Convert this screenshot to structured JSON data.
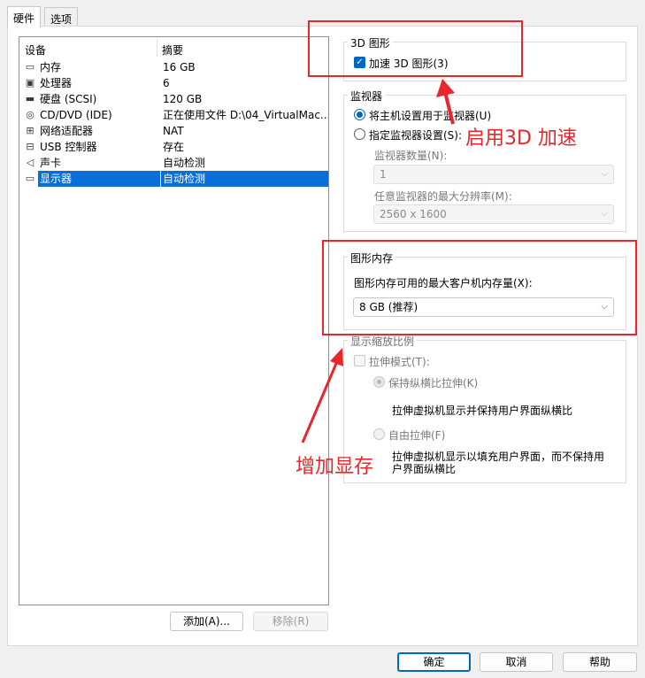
{
  "tabs": [
    "硬件",
    "选项"
  ],
  "device_list": {
    "headers": [
      "设备",
      "摘要"
    ],
    "rows": [
      {
        "name": "内存",
        "summary": "16 GB",
        "icon": "memory-icon"
      },
      {
        "name": "处理器",
        "summary": "6",
        "icon": "processor-icon"
      },
      {
        "name": "硬盘 (SCSI)",
        "summary": "120 GB",
        "icon": "hard-disk-icon"
      },
      {
        "name": "CD/DVD (IDE)",
        "summary": "正在使用文件 D:\\04_VirtualMac...",
        "icon": "cd-dvd-icon"
      },
      {
        "name": "网络适配器",
        "summary": "NAT",
        "icon": "network-adapter-icon"
      },
      {
        "name": "USB 控制器",
        "summary": "存在",
        "icon": "usb-controller-icon"
      },
      {
        "name": "声卡",
        "summary": "自动检测",
        "icon": "sound-card-icon"
      },
      {
        "name": "显示器",
        "summary": "自动检测",
        "icon": "display-icon",
        "selected": true
      }
    ],
    "add_button": "添加(A)...",
    "remove_button": "移除(R)"
  },
  "graphics3d": {
    "title": "3D 图形",
    "accelerate_label": "加速 3D 图形(3)",
    "accelerate_checked": true
  },
  "monitors": {
    "title": "监视器",
    "radio_host": "将主机设置用于监视器(U)",
    "radio_specify": "指定监视器设置(S):",
    "count_label": "监视器数量(N):",
    "count_value": "1",
    "maxres_label": "任意监视器的最大分辨率(M):",
    "maxres_value": "2560 x 1600"
  },
  "graphics_memory": {
    "title": "图形内存",
    "label": "图形内存可用的最大客户机内存量(X):",
    "value": "8 GB (推荐)"
  },
  "scaling": {
    "title": "显示缩放比例",
    "stretch_label": "拉伸模式(T):",
    "keep_ratio_label": "保持纵横比拉伸(K)",
    "keep_ratio_desc": "拉伸虚拟机显示并保持用户界面纵横比",
    "free_label": "自由拉伸(F)",
    "free_desc_line1": "拉伸虚拟机显示以填充用户界面，而不保持用",
    "free_desc_line2": "户界面纵横比"
  },
  "footer": {
    "ok": "确定",
    "cancel": "取消",
    "help": "帮助"
  },
  "annotations": {
    "enable3d": "启用3D 加速",
    "increase_vram": "增加显存",
    "color": "#e8262b"
  }
}
